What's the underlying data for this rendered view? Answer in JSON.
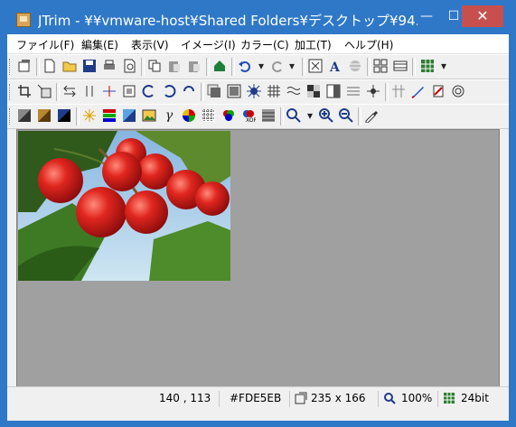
{
  "window": {
    "title": "JTrim - ¥¥vmware-host¥Shared Folders¥デスクトップ¥94..."
  },
  "titlebar": {
    "minimize_label": "—",
    "maximize_label": "☐",
    "close_label": "✕"
  },
  "menu": [
    "ファイル(F)",
    "編集(E)",
    "表示(V)",
    "イメージ(I)",
    "カラー(C)",
    "加工(T)",
    "ヘルプ(H)"
  ],
  "status": {
    "coords": "140 , 113",
    "color": "#FDE5EB",
    "size": "235 x 166",
    "zoom": "100%",
    "depth": "24bit"
  },
  "colors": {
    "title_bar": "#2F78C8",
    "close_button": "#C7504E",
    "canvas_bg": "#A0A0A0"
  }
}
